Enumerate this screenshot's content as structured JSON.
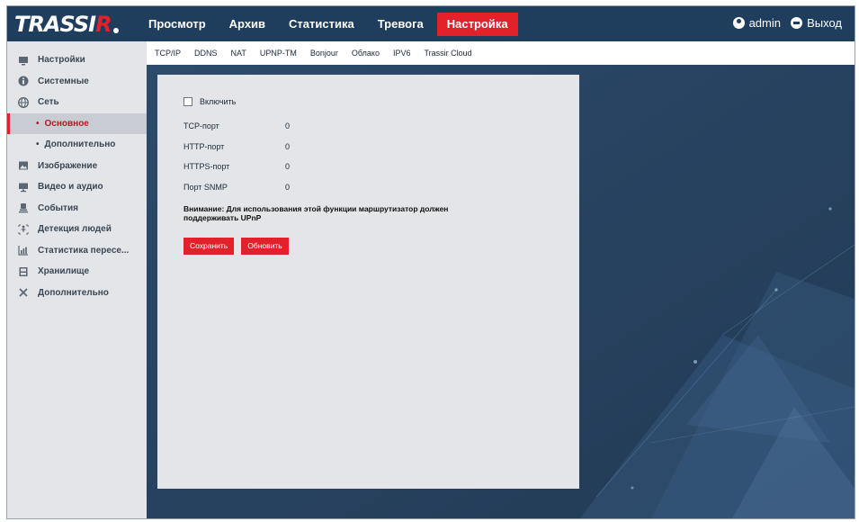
{
  "logo": {
    "main": "TRASSI",
    "accent": "R"
  },
  "nav": {
    "items": [
      {
        "label": "Просмотр"
      },
      {
        "label": "Архив"
      },
      {
        "label": "Статистика"
      },
      {
        "label": "Тревога"
      },
      {
        "label": "Настройка"
      }
    ],
    "active": "Настройка"
  },
  "user": {
    "name": "admin",
    "icon": "user-icon"
  },
  "logout": {
    "label": "Выход",
    "icon": "power-icon"
  },
  "subtabs": [
    "TCP/IP",
    "DDNS",
    "NAT",
    "UPNP-TM",
    "Bonjour",
    "Облако",
    "IPV6",
    "Trassir Cloud"
  ],
  "sidebar": {
    "items": [
      {
        "label": "Настройки",
        "icon": "monitor-icon"
      },
      {
        "label": "Системные",
        "icon": "info-icon"
      },
      {
        "label": "Сеть",
        "icon": "globe-icon"
      },
      {
        "label": "Основное",
        "active": true
      },
      {
        "label": "Дополнительно"
      },
      {
        "label": "Изображение",
        "icon": "image-icon"
      },
      {
        "label": "Видео и аудио",
        "icon": "video-icon"
      },
      {
        "label": "События",
        "icon": "event-icon"
      },
      {
        "label": "Детекция людей",
        "icon": "person-detect-icon"
      },
      {
        "label": "Статистика пересе...",
        "icon": "stats-icon"
      },
      {
        "label": "Хранилище",
        "icon": "storage-icon"
      },
      {
        "label": "Дополнительно",
        "icon": "tools-icon"
      }
    ]
  },
  "form": {
    "enable_label": "Включить",
    "enable_checked": false,
    "fields": [
      {
        "label": "TCP-порт",
        "value": "0"
      },
      {
        "label": "HTTP-порт",
        "value": "0"
      },
      {
        "label": "HTTPS-порт",
        "value": "0"
      },
      {
        "label": "Порт SNMP",
        "value": "0"
      }
    ],
    "warning": "Внимание: Для использования этой функции маршрутизатор должен поддерживать UPnP",
    "save_label": "Сохранить",
    "refresh_label": "Обновить"
  },
  "colors": {
    "accent": "#e3212b",
    "topbar": "#1f3e5e",
    "panel": "#e3e5e8",
    "sidebar": "#e3e5e8"
  }
}
